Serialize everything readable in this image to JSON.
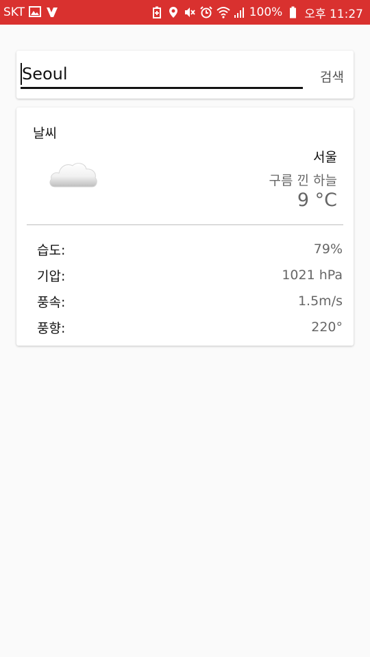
{
  "statusbar": {
    "carrier": "SKT",
    "battery": "100%",
    "time": "오후 11:27",
    "icons": [
      "gallery-icon",
      "app-icon",
      "battery-saver-icon",
      "location-icon",
      "mute-icon",
      "alarm-icon",
      "wifi-icon",
      "signal-icon",
      "battery-icon"
    ]
  },
  "search": {
    "value": "Seoul",
    "button_label": "검색"
  },
  "weather": {
    "title": "날씨",
    "icon": "cloud-icon",
    "city": "서울",
    "description": "구름 낀 하늘",
    "temperature": "9 °C",
    "details": [
      {
        "label": "습도:",
        "value": "79%"
      },
      {
        "label": "기압:",
        "value": "1021 hPa"
      },
      {
        "label": "풍속:",
        "value": "1.5m/s"
      },
      {
        "label": "풍향:",
        "value": "220°"
      }
    ]
  },
  "colors": {
    "statusbar": "#d9312f",
    "background": "#fafafa",
    "card": "#ffffff"
  }
}
